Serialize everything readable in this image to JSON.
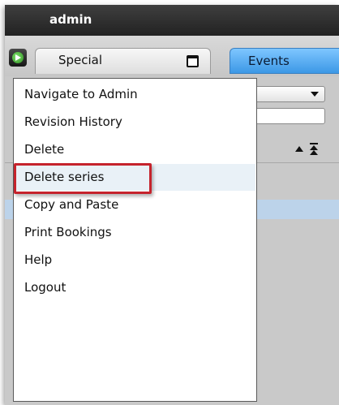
{
  "window": {
    "title": "admin"
  },
  "toolbar": {
    "home_icon": "green-arrow-icon",
    "special_tab_label": "Special",
    "events_tab_label": "Events"
  },
  "background": {
    "dropdown_value": "",
    "input_value": "",
    "sort_icons": [
      "sort-ascending-icon",
      "sort-to-top-icon"
    ]
  },
  "menu": {
    "items": [
      {
        "label": "Navigate to Admin"
      },
      {
        "label": "Revision History"
      },
      {
        "label": "Delete"
      },
      {
        "label": "Delete series"
      },
      {
        "label": "Copy and Paste"
      },
      {
        "label": "Print Bookings"
      },
      {
        "label": "Help"
      },
      {
        "label": "Logout"
      }
    ],
    "highlighted_item": "Delete series"
  },
  "colors": {
    "highlight_border": "#c5232c",
    "events_tab": "#3c98e6",
    "selected_row": "#bcd3ea"
  }
}
